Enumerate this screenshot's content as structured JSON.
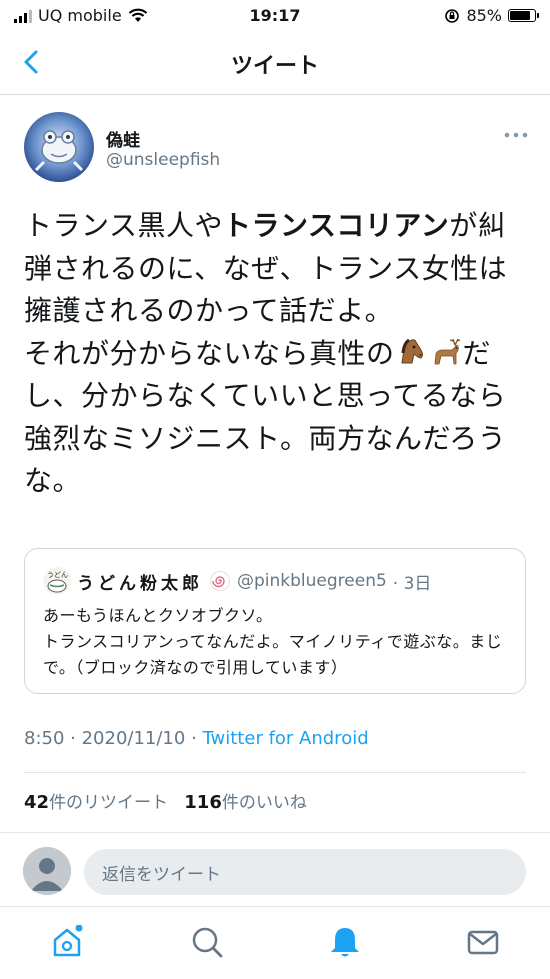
{
  "status_bar": {
    "carrier": "UQ mobile",
    "time": "19:17",
    "battery": "85%",
    "battery_level": 0.85
  },
  "nav": {
    "title": "ツイート",
    "back_icon": "chevron-left-icon"
  },
  "tweet": {
    "author_name": "偽蛙",
    "author_handle": "@unsleepfish",
    "text_1": "トランス黒人や",
    "text_bold": "トランスコリアン",
    "text_2": "が糾弾されるのに、なぜ、トランス女性は擁護されるのかって話だよ。",
    "text_3": "それが分からないなら真性の",
    "text_emoji": [
      "horse-face-emoji",
      "deer-emoji"
    ],
    "text_4": "だし、分からなくていいと思ってるなら強烈なミソジニスト。両方なんだろうな。",
    "time": "8:50",
    "date": "2020/11/10",
    "source": "Twitter for Android",
    "meta_sep": " · "
  },
  "quote": {
    "author_name": "うどん粉太郎",
    "author_handle": "@pinkbluegreen5",
    "age": "· 3日",
    "line_1": "あーもうほんとクソオブクソ。",
    "line_2": "トランスコリアンってなんだよ。マイノリティで遊ぶな。まじで。（ブロック済なので引用しています）"
  },
  "stats": {
    "retweets": "42",
    "retweets_label": "件のリツイート",
    "likes": "116",
    "likes_label": "件のいいね"
  },
  "reply": {
    "placeholder": "返信をツイート"
  },
  "tabs": [
    "home-icon",
    "search-icon",
    "notifications-icon",
    "messages-icon"
  ],
  "colors": {
    "accent": "#1da1f2",
    "secondary_text": "#657786"
  }
}
